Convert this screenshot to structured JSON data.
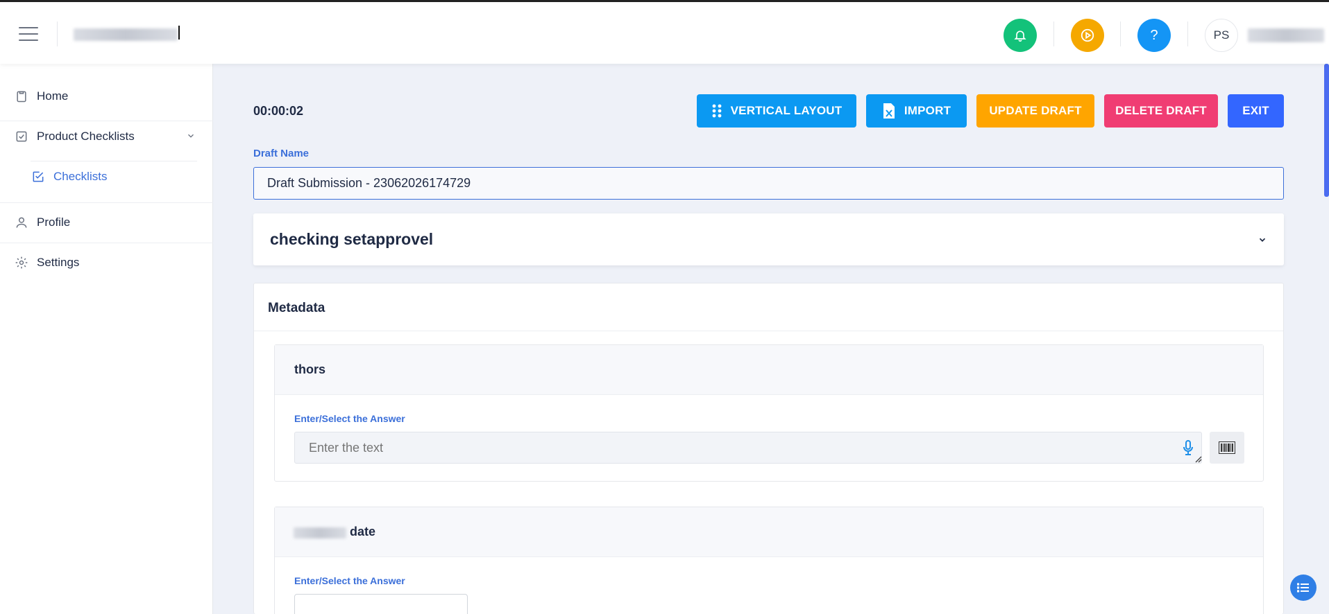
{
  "header": {
    "user_initials": "PS",
    "icons": {
      "menu": "hamburger-icon",
      "notifications": "bell-icon",
      "tutorial": "play-circle-icon",
      "help": "question-icon"
    },
    "colors": {
      "notifications": "#13c27a",
      "tutorial": "#f5a800",
      "help": "#1495f5"
    }
  },
  "sidebar": {
    "items": [
      {
        "label": "Home",
        "icon": "clipboard-icon"
      },
      {
        "label": "Product Checklists",
        "icon": "checkbox-icon"
      },
      {
        "label": "Checklists",
        "icon": "check-square-icon"
      },
      {
        "label": "Profile",
        "icon": "user-icon"
      },
      {
        "label": "Settings",
        "icon": "gear-icon"
      }
    ],
    "active_color": "#3b6fd9"
  },
  "toolbar": {
    "timer": "00:00:02",
    "vertical_layout": "VERTICAL LAYOUT",
    "import": "IMPORT",
    "update_draft": "UPDATE DRAFT",
    "delete_draft": "DELETE DRAFT",
    "exit": "EXIT",
    "colors": {
      "vertical_layout": "#0b99f2",
      "import": "#0b99f2",
      "update_draft": "#ffa500",
      "delete_draft": "#f03d73",
      "exit": "#3366ff"
    }
  },
  "draft": {
    "label": "Draft Name",
    "value": "Draft Submission - 23062026174729"
  },
  "checklist": {
    "title": "checking setapprovel"
  },
  "metadata": {
    "title": "Metadata",
    "questions": [
      {
        "title": "thors",
        "answer_label": "Enter/Select the Answer",
        "placeholder": "Enter the text"
      },
      {
        "title": "date",
        "answer_label": "Enter/Select the Answer"
      }
    ]
  }
}
